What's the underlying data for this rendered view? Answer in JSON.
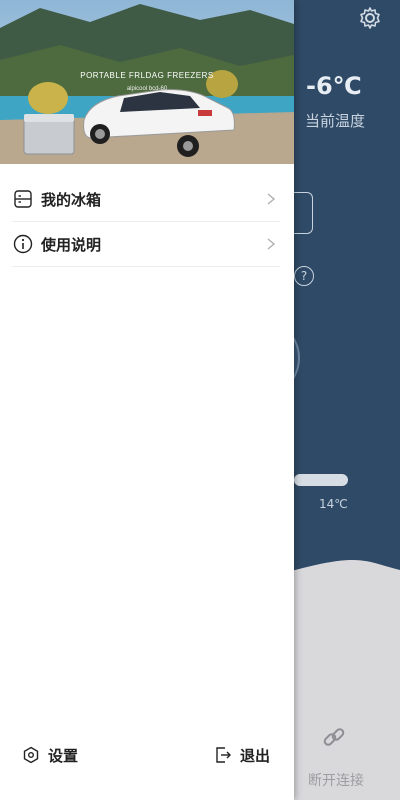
{
  "background": {
    "temperature": "-6℃",
    "temperature_label": "当前温度",
    "slider_value_label": "14℃",
    "disconnect_label": "断开连接",
    "help_glyph": "?"
  },
  "drawer": {
    "banner": {
      "title": "PORTABLE FRLDAG FREEZERS",
      "subtitle": "alpicool  bcd-60"
    },
    "menu": [
      {
        "label": "我的冰箱",
        "icon": "fridge-list-icon"
      },
      {
        "label": "使用说明",
        "icon": "info-icon"
      }
    ],
    "footer": {
      "settings_label": "设置",
      "logout_label": "退出"
    }
  },
  "colors": {
    "app_bg": "#2f4a66",
    "drawer_bg": "#ffffff",
    "wave": "#d9d9dc"
  }
}
